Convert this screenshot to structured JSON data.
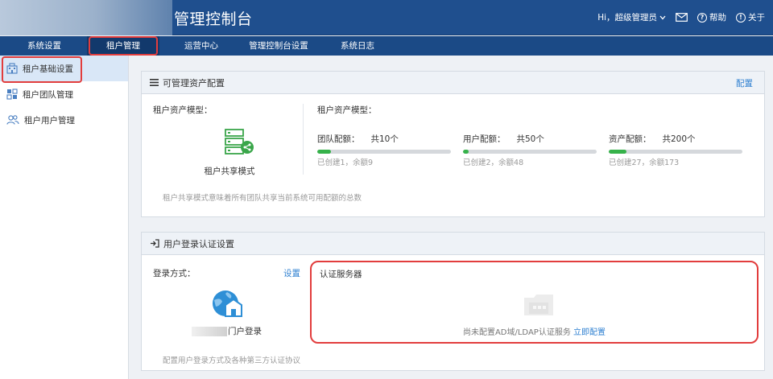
{
  "header": {
    "app_title": "管理控制台",
    "user_greeting": "Hi，超级管理员",
    "help_label": "帮助",
    "about_label": "关于"
  },
  "nav": {
    "tabs": [
      {
        "label": "系统设置"
      },
      {
        "label": "租户管理"
      },
      {
        "label": "运营中心"
      },
      {
        "label": "管理控制台设置"
      },
      {
        "label": "系统日志"
      }
    ]
  },
  "sidebar": {
    "items": [
      {
        "label": "租户基础设置",
        "icon": "building-icon"
      },
      {
        "label": "租户团队管理",
        "icon": "team-grid-icon"
      },
      {
        "label": "租户用户管理",
        "icon": "users-icon"
      }
    ]
  },
  "asset_panel": {
    "title": "可管理资产配置",
    "config_link": "配置",
    "model_label_left": "租户资产模型：",
    "model_name": "租户共享模式",
    "model_label_right": "租户资产模型：",
    "quotas": [
      {
        "label": "团队配额：",
        "total": "共10个",
        "sub": "已创建1，余额9",
        "fraction": 0.1
      },
      {
        "label": "用户配额：",
        "total": "共50个",
        "sub": "已创建2，余额48",
        "fraction": 0.04
      },
      {
        "label": "资产配额：",
        "total": "共200个",
        "sub": "已创建27，余额173",
        "fraction": 0.135
      }
    ],
    "note": "租户共享模式意味着所有团队共享当前系统可用配额的总数"
  },
  "login_panel": {
    "title": "用户登录认证设置",
    "method_label": "登录方式：",
    "settings_link": "设置",
    "portal_label": "门户登录",
    "auth_server_title": "认证服务器",
    "auth_empty_msg": "尚未配置AD域/LDAP认证服务",
    "auth_config_link": "立即配置",
    "note": "配置用户登录方式及各种第三方认证协议"
  },
  "colors": {
    "header_bg": "#1f4f8e",
    "accent_link": "#2f80d1",
    "progress_green": "#36b24a",
    "highlight_red": "#e23d3d"
  }
}
